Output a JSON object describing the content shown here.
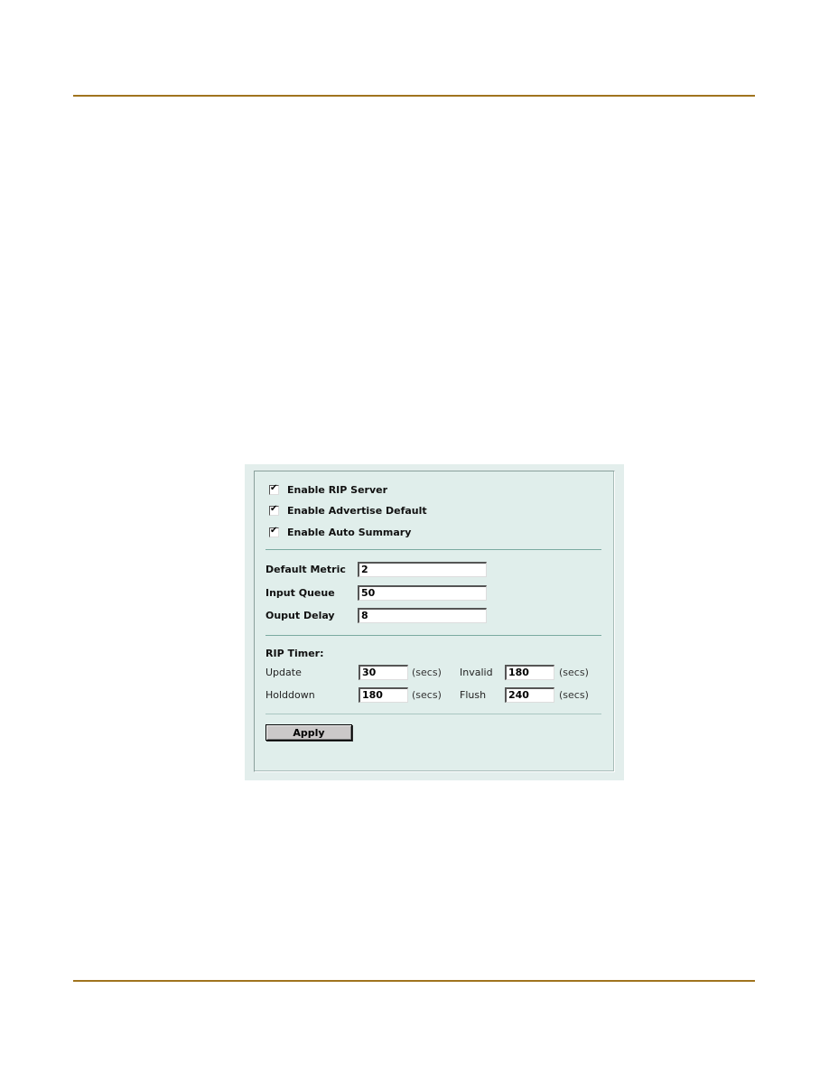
{
  "page": {
    "colors": {
      "rule": "#a0741e",
      "panel_background": "#e0eeeb",
      "divider": "#7aaaa0",
      "button_face": "#cbc8c8"
    }
  },
  "rip_settings": {
    "checkboxes": [
      {
        "label": "Enable RIP Server",
        "checked": true
      },
      {
        "label": "Enable Advertise Default",
        "checked": true
      },
      {
        "label": "Enable Auto Summary",
        "checked": true
      }
    ],
    "check_glyph": "✔",
    "fields": [
      {
        "label": "Default Metric",
        "value": "2"
      },
      {
        "label": "Input Queue",
        "value": "50"
      },
      {
        "label": "Ouput Delay",
        "value": "8"
      }
    ],
    "timer": {
      "heading": "RIP Timer:",
      "unit": "(secs)",
      "update": {
        "label": "Update",
        "value": "30"
      },
      "invalid": {
        "label": "Invalid",
        "value": "180"
      },
      "holddown": {
        "label": "Holddown",
        "value": "180"
      },
      "flush": {
        "label": "Flush",
        "value": "240"
      }
    },
    "apply_label": "Apply"
  }
}
